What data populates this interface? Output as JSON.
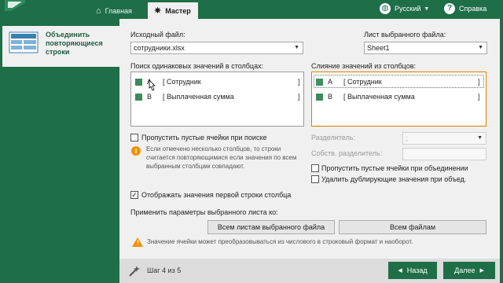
{
  "tabs": {
    "home": "Главная",
    "master": "Мастер"
  },
  "header": {
    "language": "Русский",
    "help": "Справка"
  },
  "sidebar": {
    "item_label": "Объединить повторяющиеся строки"
  },
  "form": {
    "source_file_label": "Исходный файл:",
    "source_file_value": "сотрудники.xlsx",
    "sheet_label": "Лист выбранного файла:",
    "sheet_value": "Sheet1",
    "search_label": "Поиск одинаковых значений в столбцах:",
    "merge_label": "Слияние значений из столбцов:",
    "search_columns": [
      {
        "letter": "A",
        "name": "[ Сотрудник",
        "close": "]"
      },
      {
        "letter": "B",
        "name": "[ Выплаченная сумма",
        "close": "]"
      }
    ],
    "merge_columns": [
      {
        "letter": "A",
        "name": "[ Сотрудник",
        "close": "]"
      },
      {
        "letter": "B",
        "name": "[ Выплаченная сумма",
        "close": "]"
      }
    ],
    "skip_empty_search": "Пропустить пустые ячейки при поиске",
    "info_note": "Если отмечено несколько столбцов, то строки считается повторяющимися если значения по всем выбранным столбцам совпадают.",
    "separator_label": "Разделитель:",
    "separator_value": ";",
    "custom_separator_label": "Собств. разделитель:",
    "skip_empty_merge": "Пропустить пустые ячейки при объединении",
    "remove_duplicates": "Удалить дублирующие значения при объед.",
    "show_first_row": "Отображать значения первой строки столбца",
    "apply_label": "Применить параметры выбранного листа ко:",
    "all_sheets_button": "Всем листам выбранного файла",
    "all_files_button": "Всем файлам",
    "warning_note": "Значение ячейки может преобразовываться из числового в строковый формат и наоборот."
  },
  "footer": {
    "step": "Шаг 4 из 5",
    "back": "Назад",
    "next": "Далее"
  },
  "colors": {
    "brand_green": "#1e6e48",
    "accent_orange": "#f29100"
  }
}
